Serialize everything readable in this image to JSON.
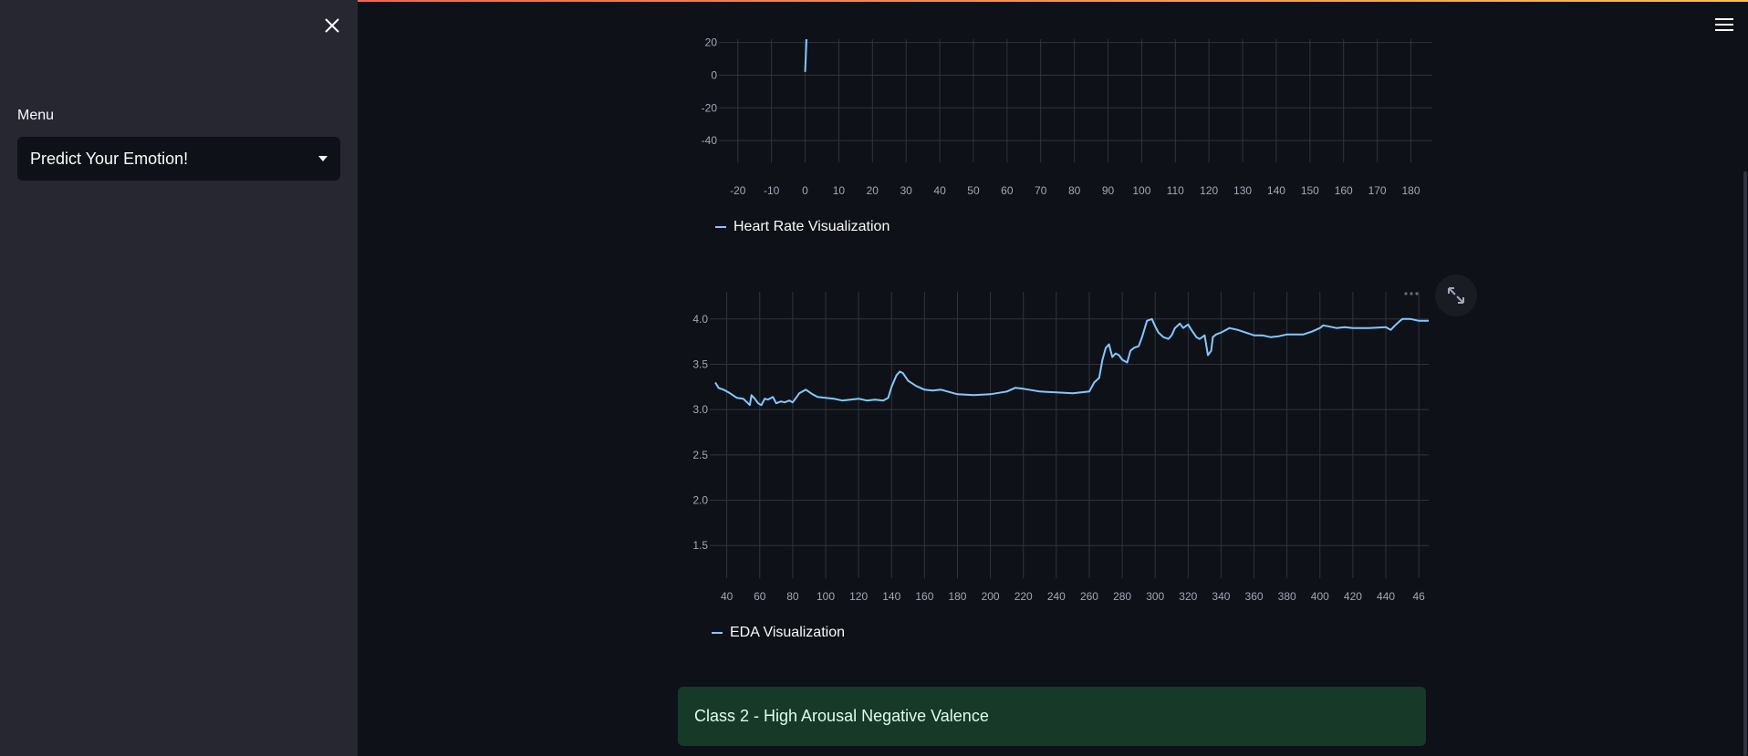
{
  "sidebar": {
    "menu_label": "Menu",
    "select_value": "Predict Your Emotion!"
  },
  "alert": {
    "text": "Class 2 - High Arousal Negative Valence"
  },
  "colors": {
    "line": "#83c9ff",
    "grid": "#31333f",
    "tick": "#a3a8b8",
    "alert_bg": "#173928"
  },
  "chart_data": [
    {
      "type": "line",
      "title": "",
      "xlabel": "",
      "ylabel": "",
      "legend": "Heart Rate Visualization",
      "xlim": [
        -24,
        188
      ],
      "ylim": [
        -50,
        22
      ],
      "x_ticks": [
        -20,
        -10,
        0,
        10,
        20,
        30,
        40,
        50,
        60,
        70,
        80,
        90,
        100,
        110,
        120,
        130,
        140,
        150,
        160,
        170,
        180
      ],
      "y_ticks": [
        20,
        0,
        -20,
        -40
      ],
      "grid": true,
      "series": [
        {
          "name": "Heart Rate Visualization",
          "x": [
            0,
            0.2,
            0.4
          ],
          "y": [
            2,
            12,
            22
          ]
        }
      ]
    },
    {
      "type": "line",
      "title": "",
      "xlabel": "",
      "ylabel": "",
      "legend": "EDA Visualization",
      "xlim": [
        33,
        466
      ],
      "ylim": [
        1.2,
        4.3
      ],
      "x_ticks": [
        40,
        60,
        80,
        100,
        120,
        140,
        160,
        180,
        200,
        220,
        240,
        260,
        280,
        300,
        320,
        340,
        360,
        380,
        400,
        420,
        440,
        460
      ],
      "x_tick_labels": [
        "40",
        "60",
        "80",
        "100",
        "120",
        "140",
        "160",
        "180",
        "200",
        "220",
        "240",
        "260",
        "280",
        "300",
        "320",
        "340",
        "360",
        "380",
        "400",
        "420",
        "440",
        "46"
      ],
      "y_ticks": [
        4.0,
        3.5,
        3.0,
        2.5,
        2.0,
        1.5
      ],
      "y_tick_labels": [
        "4.0",
        "3.5",
        "3.0",
        "2.5",
        "2.0",
        "1.5"
      ],
      "grid": true,
      "series": [
        {
          "name": "EDA Visualization",
          "x": [
            33,
            35,
            38,
            42,
            46,
            50,
            54,
            55,
            57,
            59,
            61,
            63,
            65,
            68,
            70,
            73,
            75,
            78,
            80,
            84,
            88,
            92,
            95,
            100,
            105,
            110,
            115,
            120,
            125,
            130,
            135,
            138,
            140,
            143,
            145,
            147,
            150,
            155,
            160,
            165,
            170,
            180,
            190,
            200,
            210,
            215,
            220,
            230,
            240,
            250,
            260,
            263,
            266,
            268,
            270,
            272,
            274,
            276,
            278,
            280,
            283,
            285,
            287,
            290,
            292,
            295,
            298,
            300,
            302,
            305,
            308,
            310,
            312,
            315,
            317,
            320,
            322,
            325,
            327,
            330,
            332,
            334,
            335,
            337,
            340,
            345,
            350,
            355,
            360,
            365,
            370,
            375,
            380,
            390,
            395,
            400,
            402,
            405,
            410,
            415,
            420,
            430,
            440,
            443,
            445,
            448,
            450,
            455,
            460,
            466
          ],
          "y": [
            3.3,
            3.24,
            3.22,
            3.18,
            3.13,
            3.12,
            3.05,
            3.16,
            3.12,
            3.07,
            3.05,
            3.12,
            3.11,
            3.14,
            3.07,
            3.09,
            3.08,
            3.1,
            3.08,
            3.18,
            3.22,
            3.17,
            3.14,
            3.13,
            3.12,
            3.1,
            3.11,
            3.12,
            3.1,
            3.11,
            3.1,
            3.13,
            3.25,
            3.38,
            3.42,
            3.4,
            3.32,
            3.26,
            3.22,
            3.21,
            3.22,
            3.17,
            3.16,
            3.17,
            3.2,
            3.24,
            3.23,
            3.2,
            3.19,
            3.18,
            3.2,
            3.3,
            3.35,
            3.55,
            3.68,
            3.72,
            3.58,
            3.62,
            3.6,
            3.55,
            3.52,
            3.65,
            3.68,
            3.7,
            3.8,
            3.98,
            4.0,
            3.92,
            3.85,
            3.8,
            3.78,
            3.82,
            3.9,
            3.95,
            3.9,
            3.94,
            3.88,
            3.8,
            3.78,
            3.82,
            3.6,
            3.65,
            3.8,
            3.83,
            3.85,
            3.9,
            3.88,
            3.85,
            3.82,
            3.82,
            3.8,
            3.81,
            3.83,
            3.83,
            3.86,
            3.9,
            3.93,
            3.92,
            3.9,
            3.91,
            3.9,
            3.9,
            3.91,
            3.88,
            3.92,
            3.97,
            4.0,
            4.0,
            3.98,
            3.98
          ]
        }
      ]
    }
  ]
}
